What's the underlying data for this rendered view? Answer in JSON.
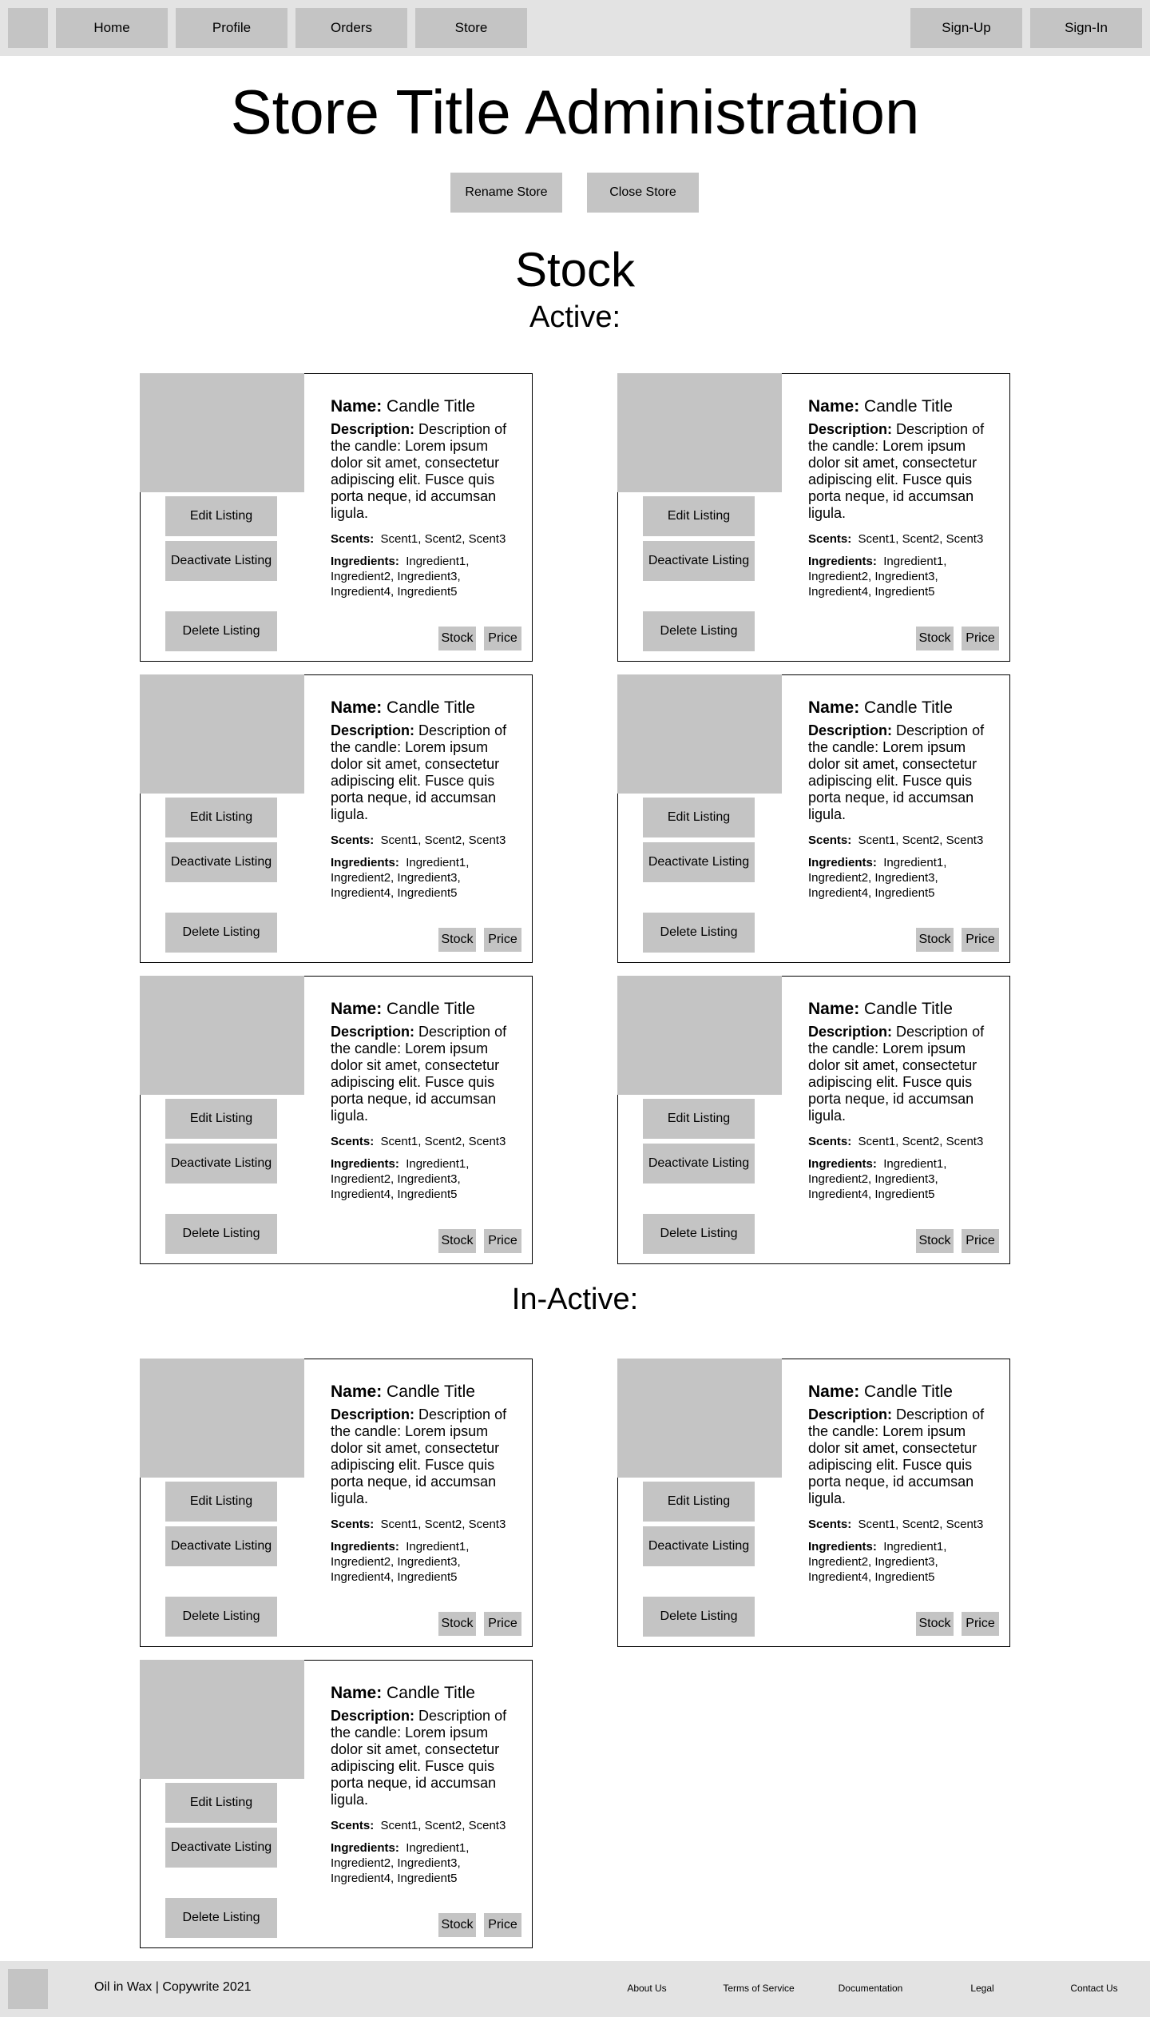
{
  "nav": {
    "items": [
      "Home",
      "Profile",
      "Orders",
      "Store"
    ],
    "right": [
      "Sign-Up",
      "Sign-In"
    ]
  },
  "page": {
    "title": "Store Title Administration",
    "rename_label": "Rename Store",
    "close_label": "Close Store",
    "stock_heading": "Stock",
    "active_heading": "Active:",
    "inactive_heading": "In-Active:"
  },
  "card": {
    "edit_label": "Edit Listing",
    "deactivate_label": "Deactivate Listing",
    "delete_label": "Delete Listing",
    "name_label": "Name:",
    "name_value": "Candle Title",
    "desc_label": "Description:",
    "desc_value": "Description of the candle: Lorem ipsum dolor sit amet, consectetur adipiscing elit. Fusce quis porta neque, id accumsan ligula.",
    "scents_label": "Scents:",
    "scents_value": "Scent1, Scent2, Scent3",
    "ingredients_label": "Ingredients:",
    "ingredients_value": "Ingredient1, Ingredient2,  Ingredient3, Ingredient4, Ingredient5",
    "stock_label": "Stock",
    "price_label": "Price"
  },
  "footer": {
    "copyright": "Oil in Wax | Copywrite 2021",
    "links": [
      "About Us",
      "Terms of Service",
      "Documentation",
      "Legal",
      "Contact Us"
    ]
  }
}
